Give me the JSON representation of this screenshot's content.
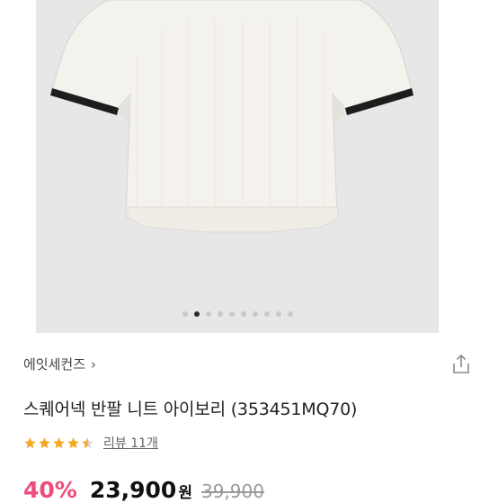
{
  "product_image": {
    "description_icon": "white-knit-top",
    "carousel": {
      "total": 10,
      "active_index": 1
    }
  },
  "brand": {
    "name": "에잇세컨즈",
    "chevron": "›"
  },
  "share_icon": "share-icon",
  "product": {
    "title": "스퀘어넥 반팔 니트 아이보리 (353451MQ70)"
  },
  "rating": {
    "value": 4.5,
    "max": 5,
    "reviews_label": "리뷰 11개"
  },
  "price": {
    "discount": "40%",
    "sale": "23,900",
    "currency": "원",
    "original": "39,900"
  },
  "colors": {
    "accent": "#ef4b7b",
    "star": "#f5a623",
    "image_bg": "#e7e7e8"
  }
}
